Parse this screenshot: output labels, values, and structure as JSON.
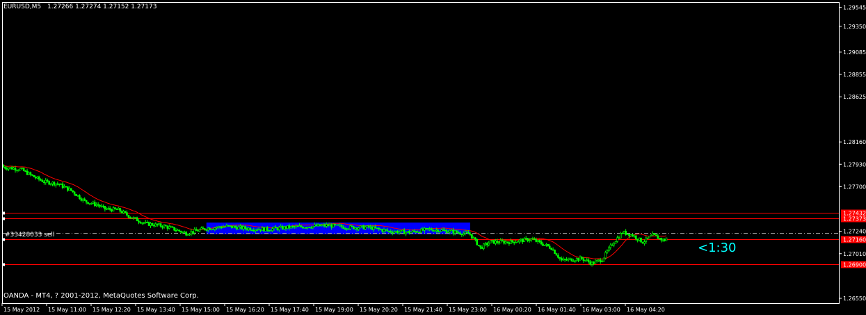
{
  "header": {
    "symbol": "EURUSD,M5",
    "ohlc": "1.27266 1.27274 1.27152 1.27173"
  },
  "footer": {
    "copyright": "OANDA - MT4, ? 2001-2012, MetaQuotes Software Corp."
  },
  "order": {
    "label": "#33428033 sell",
    "price": 1.2722
  },
  "countdown": "<1:30",
  "colors": {
    "background": "#000000",
    "bull": "#00ff00",
    "bear": "#00ff00",
    "ma": "#ff0000",
    "level_line": "#ff0000",
    "range_box": "#0000ff",
    "grid_text": "#ffffff",
    "countdown": "#00ffff"
  },
  "chart_data": {
    "type": "candlestick",
    "title": "EURUSD,M5",
    "timeframe": "M5",
    "ylim": [
      1.265,
      1.296
    ],
    "y_ticks": [
      "1.29545",
      "1.29350",
      "1.29085",
      "1.28855",
      "1.28625",
      "1.28160",
      "1.27930",
      "1.27700",
      "1.27240",
      "1.27010",
      "1.26550"
    ],
    "x_ticks": [
      "15 May 2012",
      "15 May 11:00",
      "15 May 12:20",
      "15 May 13:40",
      "15 May 15:00",
      "15 May 16:20",
      "15 May 17:40",
      "15 May 19:00",
      "15 May 20:20",
      "15 May 21:40",
      "15 May 23:00",
      "16 May 00:20",
      "16 May 01:40",
      "16 May 03:00",
      "16 May 04:20"
    ],
    "price_levels": [
      {
        "price": 1.27432,
        "label": "1.27432"
      },
      {
        "price": 1.27373,
        "label": "1.27373"
      },
      {
        "price": 1.2716,
        "label": "1.27160"
      },
      {
        "price": 1.269,
        "label": "1.26900"
      }
    ],
    "current_price": 1.27173,
    "range_box": {
      "from": "15 May 15:00",
      "to": "16 May 00:00",
      "high": 1.2733,
      "low": 1.2721
    },
    "close_path": [
      {
        "t": 0,
        "c": 1.279
      },
      {
        "t": 10,
        "c": 1.2788
      },
      {
        "t": 18,
        "c": 1.278
      },
      {
        "t": 24,
        "c": 1.2775
      },
      {
        "t": 32,
        "c": 1.2773
      },
      {
        "t": 40,
        "c": 1.2766
      },
      {
        "t": 48,
        "c": 1.2755
      },
      {
        "t": 56,
        "c": 1.2751
      },
      {
        "t": 60,
        "c": 1.2747
      },
      {
        "t": 68,
        "c": 1.2746
      },
      {
        "t": 76,
        "c": 1.2738
      },
      {
        "t": 84,
        "c": 1.2732
      },
      {
        "t": 96,
        "c": 1.2729
      },
      {
        "t": 108,
        "c": 1.2722
      },
      {
        "t": 120,
        "c": 1.2727
      },
      {
        "t": 132,
        "c": 1.2729
      },
      {
        "t": 144,
        "c": 1.2727
      },
      {
        "t": 156,
        "c": 1.2726
      },
      {
        "t": 168,
        "c": 1.2728
      },
      {
        "t": 180,
        "c": 1.2729
      },
      {
        "t": 192,
        "c": 1.273
      },
      {
        "t": 204,
        "c": 1.2728
      },
      {
        "t": 216,
        "c": 1.2728
      },
      {
        "t": 228,
        "c": 1.2724
      },
      {
        "t": 240,
        "c": 1.2723
      },
      {
        "t": 252,
        "c": 1.2726
      },
      {
        "t": 264,
        "c": 1.2724
      },
      {
        "t": 276,
        "c": 1.2721
      },
      {
        "t": 282,
        "c": 1.2707
      },
      {
        "t": 288,
        "c": 1.2713
      },
      {
        "t": 300,
        "c": 1.2713
      },
      {
        "t": 312,
        "c": 1.2716
      },
      {
        "t": 324,
        "c": 1.2707
      },
      {
        "t": 330,
        "c": 1.2694
      },
      {
        "t": 342,
        "c": 1.2696
      },
      {
        "t": 348,
        "c": 1.2691
      },
      {
        "t": 354,
        "c": 1.2695
      },
      {
        "t": 360,
        "c": 1.2711
      },
      {
        "t": 366,
        "c": 1.2723
      },
      {
        "t": 372,
        "c": 1.272
      },
      {
        "t": 378,
        "c": 1.2713
      },
      {
        "t": 384,
        "c": 1.272
      },
      {
        "t": 390,
        "c": 1.2715
      }
    ]
  }
}
